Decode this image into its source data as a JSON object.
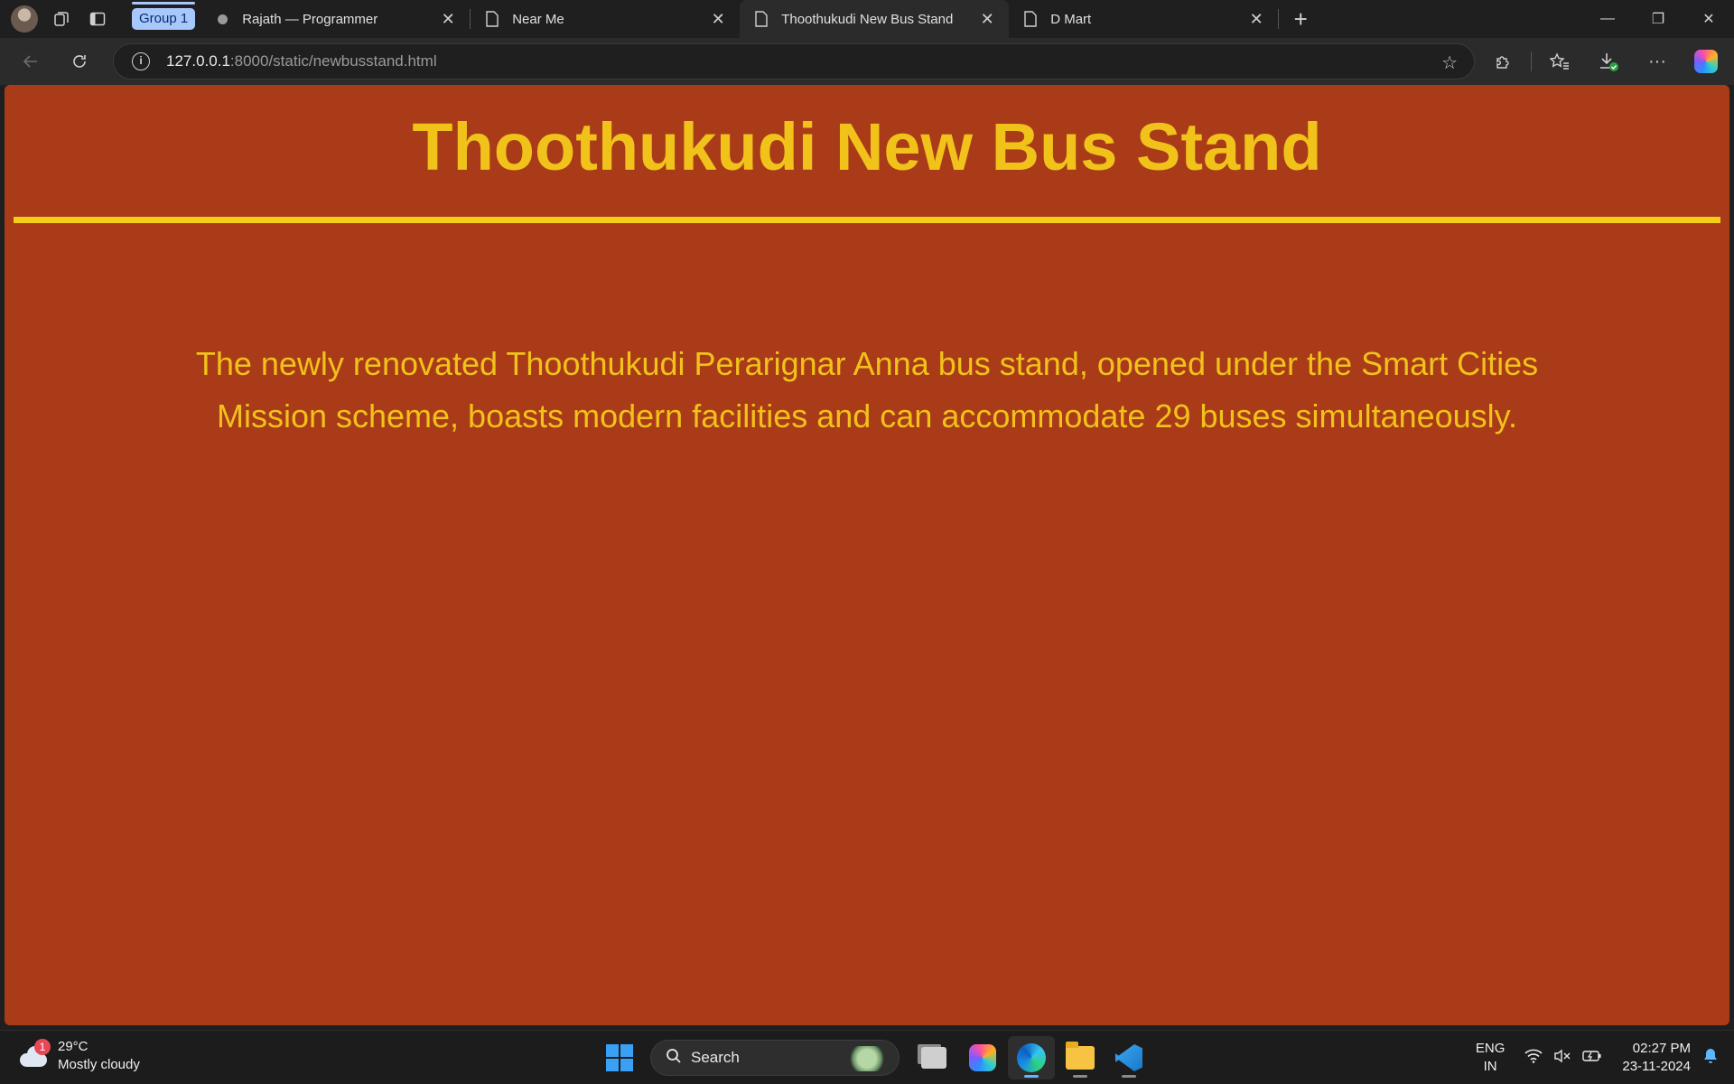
{
  "browser": {
    "tab_group": "Group 1",
    "tabs": [
      {
        "title": "Rajath — Programmer",
        "active": false
      },
      {
        "title": "Near Me",
        "active": false
      },
      {
        "title": "Thoothukudi New Bus Stand",
        "active": true
      },
      {
        "title": "D Mart",
        "active": false
      }
    ],
    "url_host": "127.0.0.1",
    "url_rest": ":8000/static/newbusstand.html"
  },
  "page": {
    "heading": "Thoothukudi New Bus Stand",
    "description": "The newly renovated Thoothukudi Perarignar Anna bus stand, opened under the Smart Cities Mission scheme, boasts modern facilities and can accommodate 29 buses simultaneously.",
    "background_color": "#aa3b19",
    "text_color": "#f0c21a"
  },
  "taskbar": {
    "weather_badge": "1",
    "weather_temp": "29°C",
    "weather_desc": "Mostly cloudy",
    "search_label": "Search",
    "lang_line1": "ENG",
    "lang_line2": "IN",
    "time": "02:27 PM",
    "date": "23-11-2024"
  }
}
